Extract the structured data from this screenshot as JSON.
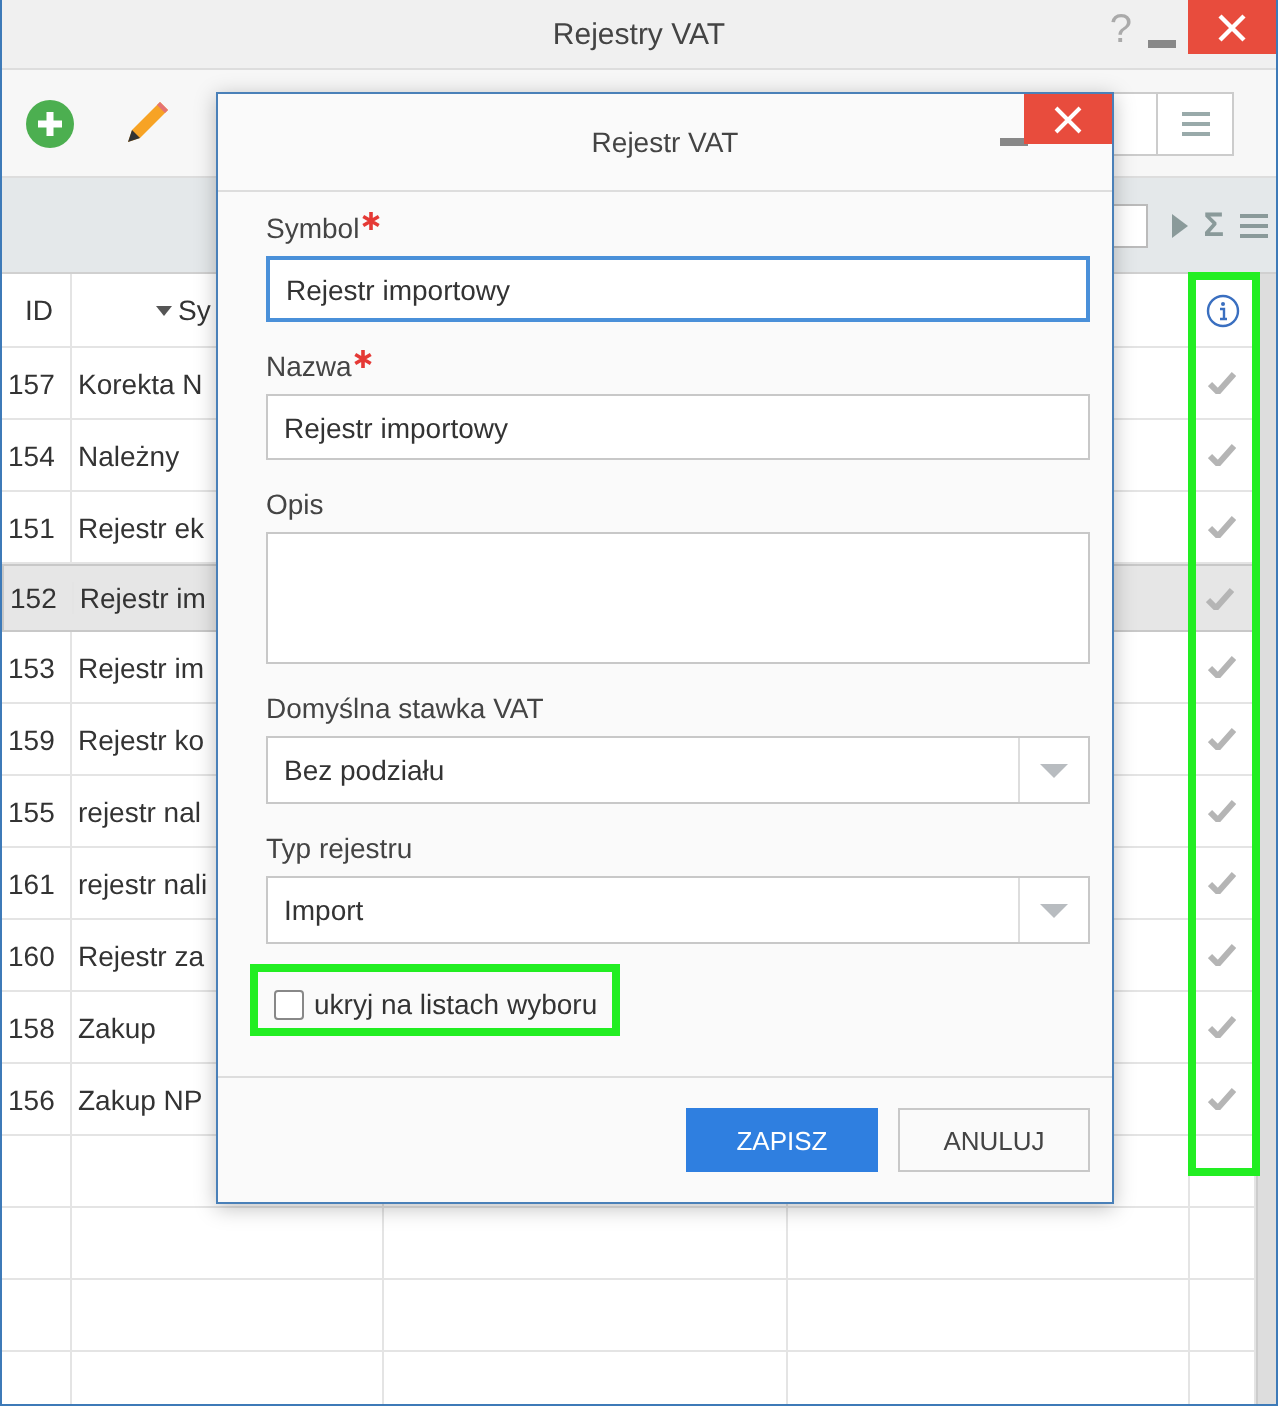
{
  "window": {
    "title": "Rejestry VAT",
    "help": "?"
  },
  "grid_toolbar": {
    "sum": "Σ"
  },
  "table": {
    "columns": [
      {
        "label": "ID"
      },
      {
        "label": "Sy",
        "sorted": true
      }
    ],
    "rows": [
      {
        "id": "157",
        "symbol": "Korekta N",
        "checked": true,
        "selected": false
      },
      {
        "id": "154",
        "symbol": "Należny",
        "checked": true,
        "selected": false
      },
      {
        "id": "151",
        "symbol": "Rejestr ek",
        "checked": true,
        "selected": false
      },
      {
        "id": "152",
        "symbol": "Rejestr im",
        "checked": true,
        "selected": true
      },
      {
        "id": "153",
        "symbol": "Rejestr im",
        "checked": true,
        "selected": false
      },
      {
        "id": "159",
        "symbol": "Rejestr ko",
        "checked": true,
        "selected": false
      },
      {
        "id": "155",
        "symbol": "rejestr nal",
        "checked": true,
        "selected": false
      },
      {
        "id": "161",
        "symbol": "rejestr nali",
        "checked": true,
        "selected": false
      },
      {
        "id": "160",
        "symbol": "Rejestr za",
        "checked": true,
        "selected": false
      },
      {
        "id": "158",
        "symbol": "Zakup",
        "checked": true,
        "selected": false
      },
      {
        "id": "156",
        "symbol": "Zakup NP",
        "checked": true,
        "selected": false
      }
    ]
  },
  "dialog": {
    "title": "Rejestr VAT",
    "fields": [
      {
        "kind": "input",
        "label": "Symbol",
        "required": true,
        "value": "Rejestr importowy",
        "focused": true
      },
      {
        "kind": "input",
        "label": "Nazwa",
        "required": true,
        "value": "Rejestr importowy",
        "focused": false
      },
      {
        "kind": "textarea",
        "label": "Opis",
        "required": false,
        "focused": false
      },
      {
        "kind": "select",
        "label": "Domyślna stawka VAT",
        "required": false,
        "value": "Bez podziału",
        "focused": false
      },
      {
        "kind": "select",
        "label": "Typ rejestru",
        "required": false,
        "value": "Import",
        "focused": false
      }
    ],
    "checkbox": {
      "label": "ukryj na listach wyboru",
      "checked": false
    },
    "buttons": [
      {
        "label": "ZAPISZ",
        "primary": true
      },
      {
        "label": "ANULUJ",
        "primary": false
      }
    ]
  }
}
